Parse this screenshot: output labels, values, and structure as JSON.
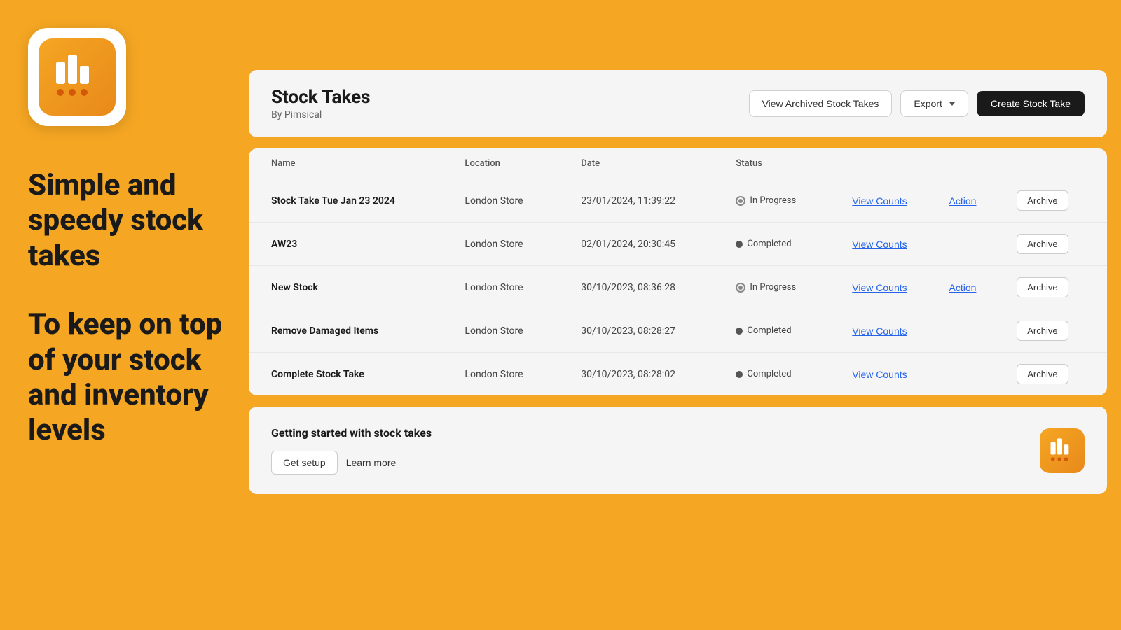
{
  "left": {
    "tagline1": "Simple and speedy stock takes",
    "tagline2": "To keep on top of your stock and inventory levels"
  },
  "header": {
    "title": "Stock Takes",
    "subtitle": "By Pimsical",
    "btn_archived": "View Archived Stock Takes",
    "btn_export": "Export",
    "btn_create": "Create Stock Take"
  },
  "table": {
    "columns": [
      "Name",
      "Location",
      "Date",
      "Status",
      "",
      "",
      ""
    ],
    "rows": [
      {
        "name": "Stock Take Tue Jan 23 2024",
        "location": "London Store",
        "date": "23/01/2024, 11:39:22",
        "status": "In Progress",
        "status_type": "progress",
        "view_counts": "View Counts",
        "action": "Action",
        "archive": "Archive"
      },
      {
        "name": "AW23",
        "location": "London Store",
        "date": "02/01/2024, 20:30:45",
        "status": "Completed",
        "status_type": "completed",
        "view_counts": "View Counts",
        "action": "",
        "archive": "Archive"
      },
      {
        "name": "New Stock",
        "location": "London Store",
        "date": "30/10/2023, 08:36:28",
        "status": "In Progress",
        "status_type": "progress",
        "view_counts": "View Counts",
        "action": "Action",
        "archive": "Archive"
      },
      {
        "name": "Remove Damaged Items",
        "location": "London Store",
        "date": "30/10/2023, 08:28:27",
        "status": "Completed",
        "status_type": "completed",
        "view_counts": "View Counts",
        "action": "",
        "archive": "Archive"
      },
      {
        "name": "Complete Stock Take",
        "location": "London Store",
        "date": "30/10/2023, 08:28:02",
        "status": "Completed",
        "status_type": "completed",
        "view_counts": "View Counts",
        "action": "",
        "archive": "Archive"
      }
    ]
  },
  "getting_started": {
    "title": "Getting started with stock takes",
    "btn_setup": "Get setup",
    "btn_learn": "Learn more"
  }
}
